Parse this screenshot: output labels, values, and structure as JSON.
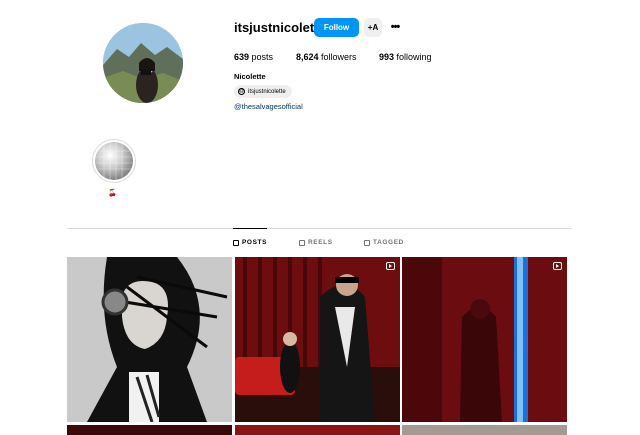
{
  "profile": {
    "username": "itsjustnicolette",
    "follow_label": "Follow",
    "suggest_label": "+A",
    "more_label": "•••",
    "full_name": "Nicolette",
    "threads_handle": "itsjustnicolette",
    "threads_icon_glyph": "@",
    "link": "@thesalvagesofficial"
  },
  "stats": {
    "posts_count": "639",
    "posts_label": "posts",
    "followers_count": "8,624",
    "followers_label": "followers",
    "following_count": "993",
    "following_label": "following"
  },
  "highlights": [
    {
      "label": "🍒"
    }
  ],
  "tabs": {
    "posts": "POSTS",
    "reels": "REELS",
    "tagged": "TAGGED",
    "active": "posts"
  },
  "grid": {
    "tiles": [
      {
        "kind": "photo",
        "subject": "black-and-white portrait with headphones",
        "reel_badge": false
      },
      {
        "kind": "photo",
        "subject": "two people on red velvet stage",
        "reel_badge": true
      },
      {
        "kind": "reel",
        "subject": "figure in red-lit room with blue light",
        "reel_badge": true
      }
    ]
  },
  "colors": {
    "accent": "#0095f6",
    "link": "#00376b",
    "divider": "#dbdbdb",
    "muted_text": "#737373"
  }
}
